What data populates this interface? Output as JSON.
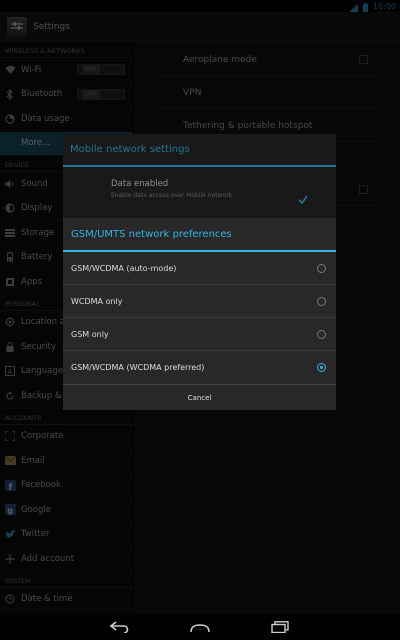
{
  "status_bar": {
    "time": "10:00"
  },
  "action_bar": {
    "title": "Settings"
  },
  "sidebar": {
    "sections": {
      "wireless": "WIRELESS & NETWORKS",
      "device": "DEVICE",
      "personal": "PERSONAL",
      "accounts": "ACCOUNTS",
      "system": "SYSTEM"
    },
    "wifi": {
      "label": "Wi-Fi",
      "toggle": "OFF"
    },
    "bluetooth": {
      "label": "Bluetooth",
      "toggle": "OFF"
    },
    "data_usage": "Data usage",
    "more": "More...",
    "sound": "Sound",
    "display": "Display",
    "storage": "Storage",
    "battery": "Battery",
    "apps": "Apps",
    "location": "Location a",
    "security": "Security",
    "language": "Language",
    "backup": "Backup & r",
    "corporate": "Corporate",
    "email": "Email",
    "facebook": "Facebook",
    "google": "Google",
    "twitter": "Twitter",
    "add_account": "Add account",
    "date_time": "Date & time"
  },
  "right_pane": {
    "aeroplane": "Aeroplane mode",
    "vpn": "VPN",
    "tethering": "Tethering & portable hotspot"
  },
  "mobile_dialog": {
    "title": "Mobile network settings",
    "data_enabled": "Data enabled",
    "data_enabled_sub": "Enable data access over Mobile network"
  },
  "pref_dialog": {
    "title": "GSM/UMTS network preferences",
    "options": [
      "GSM/WCDMA (auto-mode)",
      "WCDMA only",
      "GSM only",
      "GSM/WCDMA (WCDMA preferred)"
    ],
    "selected": "GSM/WCDMA (WCDMA preferred)",
    "cancel": "Cancel"
  },
  "colors": {
    "accent": "#33b5e5",
    "selected_bg": "#1f5f77"
  }
}
